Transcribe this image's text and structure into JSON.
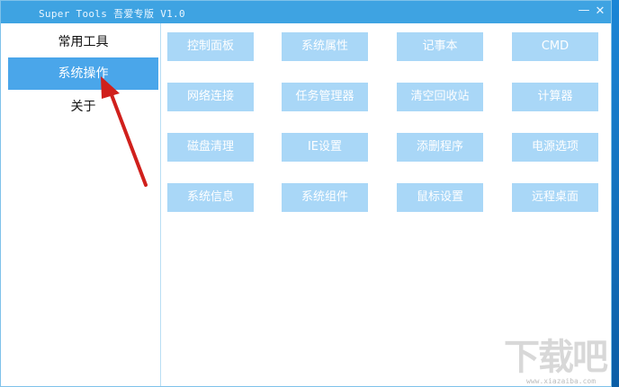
{
  "window": {
    "title": "Super Tools 吾爱专版 V1.0",
    "minimize_glyph": "—",
    "close_glyph": "✕"
  },
  "sidebar": {
    "items": [
      {
        "label": "常用工具",
        "active": false
      },
      {
        "label": "系统操作",
        "active": true
      },
      {
        "label": "关于",
        "active": false
      }
    ]
  },
  "content": {
    "buttons": [
      [
        "控制面板",
        "系统属性",
        "记事本",
        "CMD"
      ],
      [
        "网络连接",
        "任务管理器",
        "清空回收站",
        "计算器"
      ],
      [
        "磁盘清理",
        "IE设置",
        "添删程序",
        "电源选项"
      ],
      [
        "系统信息",
        "系统组件",
        "鼠标设置",
        "远程桌面"
      ]
    ]
  },
  "watermark": {
    "text": "下载吧",
    "url": "www.xiazaiba.com"
  },
  "colors": {
    "titlebar": "#3ea3e2",
    "active_nav": "#4aa6ea",
    "button": "#a9d7f7",
    "annotation_arrow": "#d0201c"
  }
}
